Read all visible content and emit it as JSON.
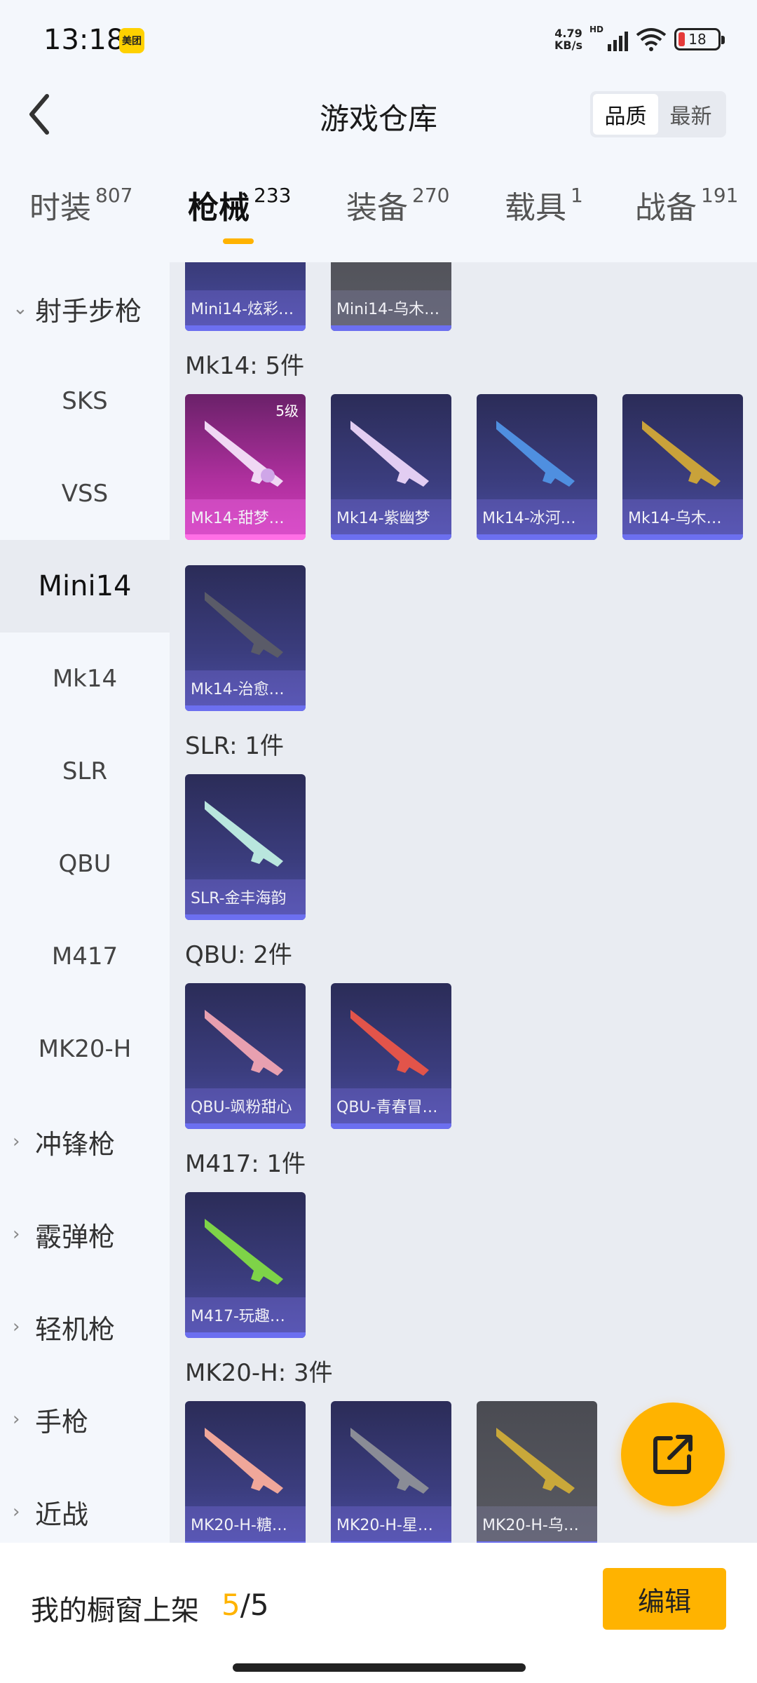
{
  "status_bar": {
    "time": "13:18",
    "app_badge": "美团",
    "net_speed": "4.79",
    "net_unit": "KB/s",
    "signal_label": "HD",
    "battery": "18"
  },
  "header": {
    "title": "游戏仓库",
    "sort_options": [
      "品质",
      "最新"
    ],
    "sort_active": "品质"
  },
  "tabs": [
    {
      "label": "时装",
      "count": "807"
    },
    {
      "label": "枪械",
      "count": "233"
    },
    {
      "label": "装备",
      "count": "270"
    },
    {
      "label": "载具",
      "count": "1"
    },
    {
      "label": "战备",
      "count": "191"
    }
  ],
  "active_tab": "枪械",
  "sidebar": {
    "group_expanded": "射手步枪",
    "sub_items": [
      "SKS",
      "VSS",
      "Mini14",
      "Mk14",
      "SLR",
      "QBU",
      "M417",
      "MK20-H"
    ],
    "selected": "Mini14",
    "groups": [
      "冲锋枪",
      "霰弹枪",
      "轻机枪",
      "手枪",
      "近战"
    ]
  },
  "content": {
    "top_partial": [
      {
        "name": "Mini14-炫彩…",
        "style": "blue"
      },
      {
        "name": "Mini14-乌木…",
        "style": "grey"
      }
    ],
    "sections": [
      {
        "title": "Mk14: 5件",
        "items": [
          {
            "name": "Mk14-甜梦…",
            "style": "pink",
            "level": "5级"
          },
          {
            "name": "Mk14-紫幽梦",
            "style": "blue"
          },
          {
            "name": "Mk14-冰河…",
            "style": "blue"
          },
          {
            "name": "Mk14-乌木…",
            "style": "blue"
          },
          {
            "name": "Mk14-治愈…",
            "style": "blue"
          }
        ]
      },
      {
        "title": "SLR: 1件",
        "items": [
          {
            "name": "SLR-金丰海韵",
            "style": "blue"
          }
        ]
      },
      {
        "title": "QBU: 2件",
        "items": [
          {
            "name": "QBU-飒粉甜心",
            "style": "blue"
          },
          {
            "name": "QBU-青春冒…",
            "style": "blue"
          }
        ]
      },
      {
        "title": "M417: 1件",
        "items": [
          {
            "name": "M417-玩趣…",
            "style": "blue"
          }
        ]
      },
      {
        "title": "MK20-H: 3件",
        "items": [
          {
            "name": "MK20-H-糖…",
            "style": "blue"
          },
          {
            "name": "MK20-H-星…",
            "style": "blue"
          },
          {
            "name": "MK20-H-乌…",
            "style": "grey"
          }
        ]
      }
    ]
  },
  "bottom": {
    "label": "我的橱窗上架",
    "current": "5",
    "separator": "/",
    "total": "5",
    "edit_label": "编辑"
  },
  "colors": {
    "accent": "#ffb300",
    "card_blue": "#3b3d7e",
    "card_pink": "#b0309f",
    "card_grey": "#55565e"
  }
}
